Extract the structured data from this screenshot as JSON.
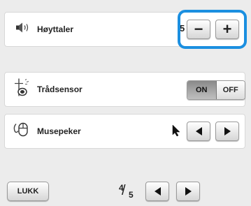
{
  "settings": {
    "speaker": {
      "label": "Høyttaler",
      "value": "5",
      "icon": "speaker-icon",
      "minus": "−",
      "plus": "+"
    },
    "thread_sensor": {
      "label": "Trådsensor",
      "icon": "thread-spool-icon",
      "on": "ON",
      "off": "OFF",
      "state": "ON"
    },
    "mouse_pointer": {
      "label": "Musepeker",
      "icon": "mouse-icon",
      "cursor_icon": "arrow-pointer-icon"
    }
  },
  "footer": {
    "close_label": "LUKK",
    "page_current": "4",
    "page_total": "5"
  },
  "colors": {
    "highlight": "#1b8fe0",
    "background": "#ececec"
  }
}
